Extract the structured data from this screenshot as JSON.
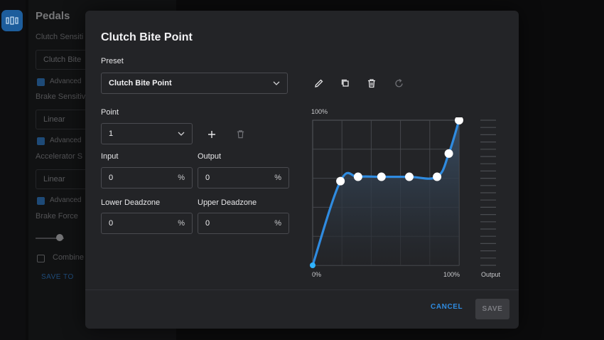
{
  "background": {
    "panel_title": "Pedals",
    "clutch_sensitivity_label": "Clutch Sensiti",
    "clutch_field": "Clutch Bite",
    "advanced_1": "Advanced",
    "brake_sensitivity_label": "Brake Sensitiv",
    "brake_field": "Linear",
    "advanced_2": "Advanced",
    "accelerator_label": "Accelerator S",
    "accelerator_field": "Linear",
    "advanced_3": "Advanced",
    "brake_force_label": "Brake Force",
    "combined_label": "Combine",
    "save_to_label": "SAVE TO"
  },
  "modal": {
    "title": "Clutch Bite Point",
    "preset_label": "Preset",
    "preset_value": "Clutch Bite Point",
    "point_label": "Point",
    "point_value": "1",
    "input_label": "Input",
    "input_value": "0",
    "output_label": "Output",
    "output_value": "0",
    "lower_deadzone_label": "Lower Deadzone",
    "lower_deadzone_value": "0",
    "upper_deadzone_label": "Upper Deadzone",
    "upper_deadzone_value": "0",
    "unit": "%",
    "cancel_label": "CANCEL",
    "save_label": "SAVE"
  },
  "icons": [
    "edit-icon",
    "copy-icon",
    "delete-icon",
    "reset-icon",
    "add-icon",
    "delete-point-icon",
    "chevron-down-icon"
  ],
  "colors": {
    "accent": "#2f8be0",
    "curve": "#2f8be0",
    "modal_bg": "#232427"
  },
  "chart_data": {
    "type": "line",
    "y_top_label": "100%",
    "x_left_label": "0%",
    "x_right_label": "100%",
    "output_label": "Output",
    "xlim": [
      0,
      100
    ],
    "ylim": [
      0,
      100
    ],
    "grid": true,
    "points": [
      {
        "x": 0,
        "y": 0
      },
      {
        "x": 19,
        "y": 58
      },
      {
        "x": 31,
        "y": 61
      },
      {
        "x": 47,
        "y": 61
      },
      {
        "x": 66,
        "y": 61
      },
      {
        "x": 85,
        "y": 61
      },
      {
        "x": 93,
        "y": 77
      },
      {
        "x": 100,
        "y": 100
      }
    ]
  }
}
